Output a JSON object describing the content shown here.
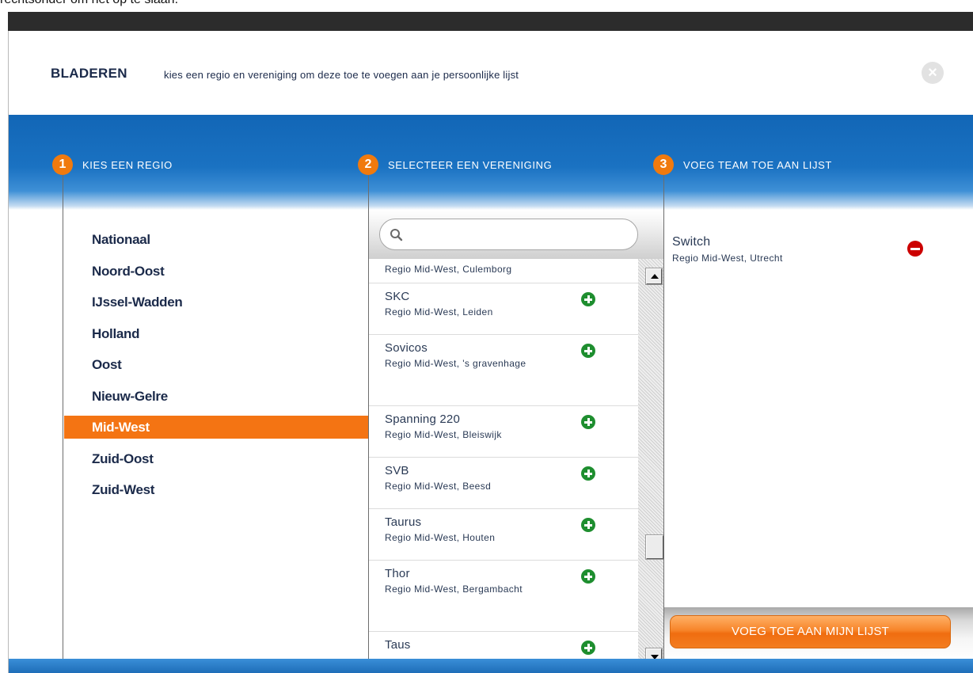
{
  "page": {
    "top_caption": "rechtsonder om het op te slaan."
  },
  "header": {
    "title": "BLADEREN",
    "subtitle": "kies een regio en vereniging om deze toe te voegen aan je persoonlijke lijst",
    "close_icon": "close-icon"
  },
  "steps": [
    {
      "number": "1",
      "label": "KIES EEN REGIO"
    },
    {
      "number": "2",
      "label": "SELECTEER EEN VERENIGING"
    },
    {
      "number": "3",
      "label": "VOEG TEAM TOE AAN LIJST"
    }
  ],
  "regions": {
    "items": [
      {
        "label": "Nationaal"
      },
      {
        "label": "Noord-Oost"
      },
      {
        "label": "IJssel-Wadden"
      },
      {
        "label": "Holland"
      },
      {
        "label": "Oost"
      },
      {
        "label": "Nieuw-Gelre"
      },
      {
        "label": "Mid-West"
      },
      {
        "label": "Zuid-Oost"
      },
      {
        "label": "Zuid-West"
      }
    ],
    "selected": "Mid-West"
  },
  "search": {
    "placeholder": "",
    "value": ""
  },
  "clubs": {
    "items": [
      {
        "name": "",
        "location": "Regio Mid-West, Culemborg"
      },
      {
        "name": "SKC",
        "location": "Regio Mid-West, Leiden"
      },
      {
        "name": "Sovicos",
        "location": "Regio Mid-West, 's gravenhage"
      },
      {
        "name": "Spanning 220",
        "location": "Regio Mid-West, Bleiswijk"
      },
      {
        "name": "SVB",
        "location": "Regio Mid-West, Beesd"
      },
      {
        "name": "Taurus",
        "location": "Regio Mid-West, Houten"
      },
      {
        "name": "Thor",
        "location": "Regio Mid-West, Bergambacht"
      },
      {
        "name": "Taus",
        "location": ""
      }
    ]
  },
  "selected_team": {
    "name": "Switch",
    "location": "Regio Mid-West, Utrecht"
  },
  "actions": {
    "add_to_list_label": "VOEG TOE AAN MIJN LIJST"
  },
  "colors": {
    "accent_orange": "#f47413",
    "header_blue": "#1a6fbe",
    "add_green": "#1e8e2f",
    "remove_red": "#cc0000",
    "text_navy": "#1b2a4a"
  }
}
